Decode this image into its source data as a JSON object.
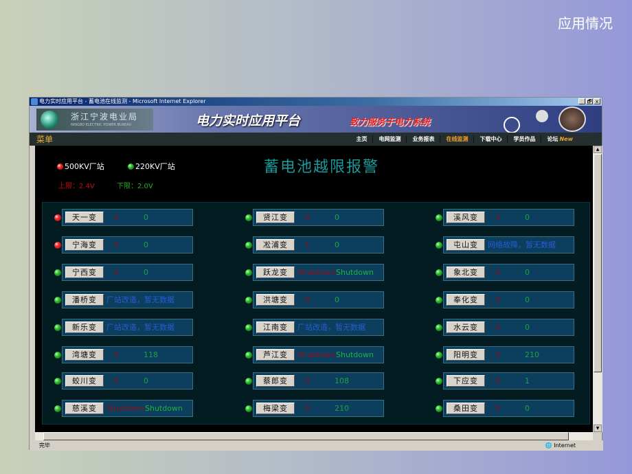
{
  "slide_title": "应用情况",
  "window": {
    "title": "电力实时应用平台 - 蓄电池在线监测 - Microsoft Internet Explorer",
    "controls": [
      "_",
      "🗗",
      "x"
    ]
  },
  "banner": {
    "org_name": "浙江宁波电业局",
    "org_en": "NINGBO ELECTRIC POWER BUREAU",
    "platform": "电力实时应用平台",
    "slogan": "致力服务于电力系统"
  },
  "menu": {
    "label": "菜单",
    "items": [
      "主页",
      "电网监测",
      "业务报表",
      "在线监测",
      "下载中心",
      "学员作品",
      "论坛"
    ],
    "active": "在线监测",
    "new_badge": "New"
  },
  "legend": {
    "kv500": "500KV厂站",
    "kv220": "220KV厂站",
    "upper": "上限：2.4V",
    "lower": "下限：2.0V"
  },
  "page_title": "蓄电池越限报警",
  "colors": {
    "alarm": "#ff3030",
    "normal": "#30c030",
    "value1": "#8a1020",
    "value2": "#20a040",
    "message": "#2a5ad8"
  },
  "stations": [
    {
      "name": "天一变",
      "led": "red",
      "v1": "0",
      "v2": "0"
    },
    {
      "name": "贤江变",
      "led": "green",
      "v1": "0",
      "v2": "0"
    },
    {
      "name": "溪风变",
      "led": "green",
      "v1": "3",
      "v2": "0"
    },
    {
      "name": "宁海变",
      "led": "red",
      "v1": "0",
      "v2": "0"
    },
    {
      "name": "凇浦变",
      "led": "green",
      "v1": "1",
      "v2": "0"
    },
    {
      "name": "屯山变",
      "led": "green",
      "message": "网络故障，暂无数据"
    },
    {
      "name": "宁西变",
      "led": "green",
      "v1": "0",
      "v2": "0"
    },
    {
      "name": "跃龙变",
      "led": "green",
      "sd1": "Shutdown",
      "sd2": "Shutdown"
    },
    {
      "name": "象北变",
      "led": "green",
      "v1": "0",
      "v2": "0"
    },
    {
      "name": "潘桥变",
      "led": "green",
      "message": "厂站改造，暂无数据"
    },
    {
      "name": "洪塘变",
      "led": "green",
      "v1": "0",
      "v2": "0"
    },
    {
      "name": "奉化变",
      "led": "green",
      "v1": "0",
      "v2": "0"
    },
    {
      "name": "新乐变",
      "led": "green",
      "message": "厂站改造，暂无数据"
    },
    {
      "name": "江南变",
      "led": "green",
      "message": "厂站改造，暂无数据"
    },
    {
      "name": "水云变",
      "led": "green",
      "v1": "0",
      "v2": "0"
    },
    {
      "name": "湾塘变",
      "led": "green",
      "v1": "0",
      "v2": "118"
    },
    {
      "name": "芦江变",
      "led": "green",
      "sd1": "Shutdown",
      "sd2": "Shutdown"
    },
    {
      "name": "阳明变",
      "led": "green",
      "v1": "0",
      "v2": "210"
    },
    {
      "name": "蛟川变",
      "led": "green",
      "v1": "0",
      "v2": "0"
    },
    {
      "name": "蔡郎变",
      "led": "green",
      "v1": "0",
      "v2": "108"
    },
    {
      "name": "下应变",
      "led": "green",
      "v1": "0",
      "v2": "1"
    },
    {
      "name": "慈溪变",
      "led": "green",
      "sd1": "Shutdown",
      "sd2": "Shutdown"
    },
    {
      "name": "梅梁变",
      "led": "green",
      "v1": "0",
      "v2": "210"
    },
    {
      "name": "桑田变",
      "led": "green",
      "v1": "0",
      "v2": "0"
    }
  ],
  "statusbar": {
    "status": "完毕",
    "zone": "Internet"
  }
}
